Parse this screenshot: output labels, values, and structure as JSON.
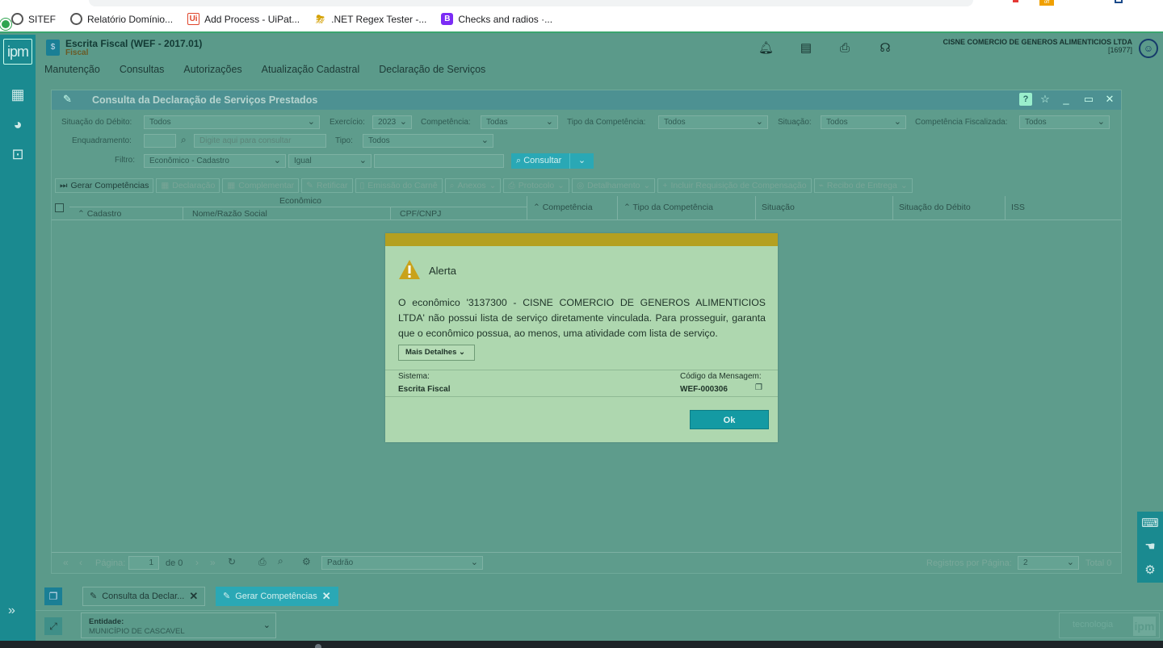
{
  "bookmarks": [
    {
      "label": "SITEF",
      "icon": "globe-icon"
    },
    {
      "label": "Relatório Domínio...",
      "icon": "globe-icon"
    },
    {
      "label": "Add Process - UiPat...",
      "icon": "uipath-icon"
    },
    {
      "label": ".NET Regex Tester -...",
      "icon": "weather-icon"
    },
    {
      "label": "Checks and radios ·...",
      "icon": "bootstrap-icon"
    }
  ],
  "extensions": {
    "off_badge": "off"
  },
  "app": {
    "logo": "ipm",
    "module_title": "Escrita Fiscal (WEF - 2017.01)",
    "module_subtitle": "Fiscal",
    "company_name": "CISNE COMERCIO DE GENEROS ALIMENTICIOS LTDA",
    "company_code": "[16977]"
  },
  "menu": [
    "Manutenção",
    "Consultas",
    "Autorizações",
    "Atualização Cadastral",
    "Declaração de Serviços"
  ],
  "window": {
    "title": "Consulta da Declaração de Serviços Prestados",
    "help": "?"
  },
  "filters": {
    "situacao_debito_label": "Situação do Débito:",
    "situacao_debito_value": "Todos",
    "exercicio_label": "Exercício:",
    "exercicio_value": "2023",
    "competencia_label": "Competência:",
    "competencia_value": "Todas",
    "tipo_competencia_label": "Tipo da Competência:",
    "tipo_competencia_value": "Todos",
    "situacao_label": "Situação:",
    "situacao_value": "Todos",
    "competencia_fiscalizada_label": "Competência Fiscalizada:",
    "competencia_fiscalizada_value": "Todos",
    "enquadramento_label": "Enquadramento:",
    "enquadramento_placeholder": "Digite aqui para consultar",
    "tipo_label": "Tipo:",
    "tipo_value": "Todos",
    "filtro_label": "Filtro:",
    "filtro_value": "Econômico - Cadastro",
    "operador_value": "Igual",
    "consultar_label": "Consultar"
  },
  "toolbar": [
    "Gerar Competências",
    "Declaração",
    "Complementar",
    "Retificar",
    "Emissão do Carnê",
    "Anexos",
    "Protocolo",
    "Detalhamento",
    "Incluir Requisição de Compensação",
    "Recibo de Entrega"
  ],
  "grid": {
    "group_header": "Econômico",
    "columns": [
      "Cadastro",
      "Nome/Razão Social",
      "CPF/CNPJ",
      "Competência",
      "Tipo da Competência",
      "Situação",
      "Situação do Débito",
      "ISS"
    ]
  },
  "pager": {
    "page_label": "Página:",
    "page_value": "1",
    "of_label": "de 0",
    "layout_value": "Padrão",
    "per_page_label": "Registros por Página:",
    "per_page_value": "2",
    "total_label": "Total 0"
  },
  "tabs": [
    {
      "label": "Consulta da Declar...",
      "active": false
    },
    {
      "label": "Gerar Competências",
      "active": true
    }
  ],
  "entity": {
    "label": "Entidade:",
    "value": "MUNICÍPIO DE CASCAVEL"
  },
  "brand": {
    "text": "tecnologia",
    "logo": "ipm"
  },
  "modal": {
    "title": "Alerta",
    "message": "O econômico '3137300 - CISNE COMERCIO DE GENEROS ALIMENTICIOS LTDA' não possui lista de serviço diretamente vinculada. Para prosseguir, garanta que o econômico possua, ao menos, uma atividade com lista de serviço.",
    "details_label": "Mais Detalhes",
    "system_label": "Sistema:",
    "system_value": "Escrita Fiscal",
    "code_label": "Código da Mensagem:",
    "code_value": "WEF-000306",
    "ok_label": "Ok"
  }
}
